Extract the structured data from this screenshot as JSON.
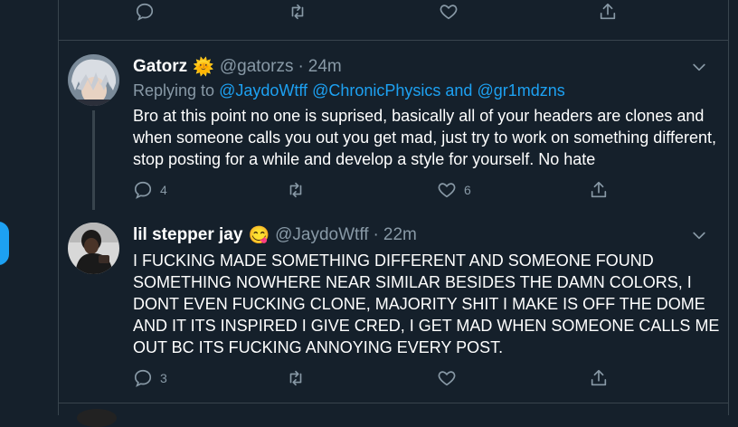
{
  "top_actions": {
    "reply_count": "",
    "retweet_count": "",
    "like_count": ""
  },
  "tweets": [
    {
      "name": "Gatorz",
      "emoji": "🌞",
      "handle": "@gatorzs",
      "sep": "·",
      "time": "24m",
      "replying_prefix": "Replying to",
      "replying_users": [
        "@JaydoWtff",
        "@ChronicPhysics",
        "and",
        "@gr1mdzns"
      ],
      "text": "Bro at this point no one is suprised, basically all of your headers are clones and when someone calls you out you get mad, just try to work on something different, stop posting for a while and develop a style for yourself. No hate",
      "reply_count": "4",
      "retweet_count": "",
      "like_count": "6"
    },
    {
      "name": "lil stepper jay",
      "emoji": "😋",
      "handle": "@JaydoWtff",
      "sep": "·",
      "time": "22m",
      "text": "I FUCKING MADE SOMETHING DIFFERENT AND SOMEONE FOUND SOMETHING NOWHERE NEAR SIMILAR BESIDES THE DAMN COLORS, I DONT EVEN FUCKING CLONE, MAJORITY SHIT I MAKE IS OFF THE DOME AND IT ITS INSPIRED I GIVE CRED, I GET MAD WHEN SOMEONE CALLS ME OUT BC ITS FUCKING ANNOYING EVERY POST.",
      "reply_count": "3",
      "retweet_count": "",
      "like_count": ""
    }
  ],
  "colors": {
    "bg": "#15202b",
    "border": "#38444d",
    "muted": "#8899a6",
    "accent": "#1da1f2",
    "text": "#ffffff"
  }
}
